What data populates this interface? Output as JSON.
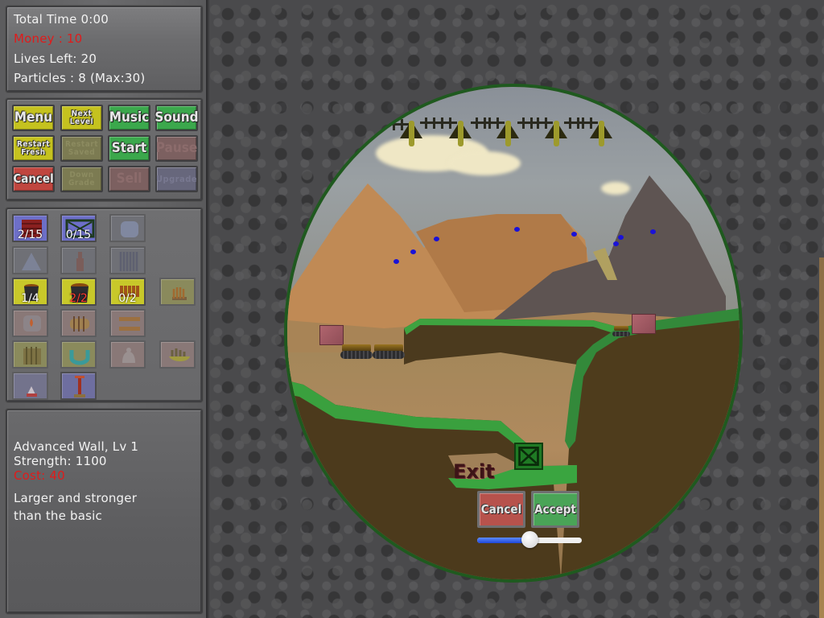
{
  "stats": {
    "total_time": "Total Time 0:00",
    "money": "Money : 10",
    "lives": "Lives Left: 20",
    "particles": "Particles : 8 (Max:30)"
  },
  "controls": [
    {
      "id": "menu",
      "label": "Menu",
      "color": "yellow",
      "enabled": true
    },
    {
      "id": "next-level",
      "label": "Next Level",
      "color": "yellow",
      "enabled": true
    },
    {
      "id": "music",
      "label": "Music",
      "color": "green",
      "enabled": true
    },
    {
      "id": "sound",
      "label": "Sound",
      "color": "green",
      "enabled": true
    },
    {
      "id": "restart-fresh",
      "label": "Restart Fresh",
      "color": "yellow",
      "enabled": true
    },
    {
      "id": "restart-saved",
      "label": "Restart Saved",
      "color": "yellow",
      "enabled": false
    },
    {
      "id": "start",
      "label": "Start",
      "color": "green",
      "enabled": true
    },
    {
      "id": "pause",
      "label": "Pause",
      "color": "red",
      "enabled": false
    },
    {
      "id": "cancel",
      "label": "Cancel",
      "color": "red",
      "enabled": true
    },
    {
      "id": "down-grade",
      "label": "Down Grade",
      "color": "yellow",
      "enabled": false
    },
    {
      "id": "sell",
      "label": "Sell",
      "color": "red",
      "enabled": false
    },
    {
      "id": "upgrade",
      "label": "Upgrade",
      "color": "blue",
      "enabled": false
    }
  ],
  "items": [
    {
      "id": "basic-wall",
      "icon": "brick-wall-icon",
      "count": "2/15",
      "count_color": "white",
      "state": "blue"
    },
    {
      "id": "advanced-wall",
      "icon": "steel-frame-icon",
      "count": "0/15",
      "count_color": "white",
      "state": "blue"
    },
    {
      "id": "dome",
      "icon": "dome-icon",
      "count": "",
      "state": "dim-gray"
    },
    {
      "id": "pyramid",
      "icon": "pyramid-icon",
      "count": "",
      "state": "dim-gray"
    },
    {
      "id": "bottle",
      "icon": "bottle-icon",
      "count": "",
      "state": "dim-gray"
    },
    {
      "id": "spring-coil",
      "icon": "coil-icon",
      "count": "",
      "state": "dim-gray"
    },
    {
      "id": "small-cauldron",
      "icon": "cauldron-icon",
      "count": "1/4",
      "count_color": "white",
      "state": "yellow"
    },
    {
      "id": "large-cauldron",
      "icon": "cauldron-icon",
      "count": "2/2",
      "count_color": "red",
      "state": "yellow"
    },
    {
      "id": "spike-roller",
      "icon": "spike-roller-icon",
      "count": "0/2",
      "count_color": "white",
      "state": "yellow"
    },
    {
      "id": "spike-bed",
      "icon": "spike-bed-icon",
      "count": "",
      "state": "dim-yellow"
    },
    {
      "id": "flame-tank",
      "icon": "flame-tank-icon",
      "count": "",
      "state": "dim-pink"
    },
    {
      "id": "barrel-cannon",
      "icon": "barrel-icon",
      "count": "",
      "state": "dim-pink"
    },
    {
      "id": "plank-stack",
      "icon": "planks-icon",
      "count": "",
      "state": "dim-pink"
    },
    {
      "id": "fence",
      "icon": "fence-icon",
      "count": "",
      "state": "dim-yellow"
    },
    {
      "id": "u-magnet",
      "icon": "magnet-icon",
      "count": "",
      "state": "dim-yellow"
    },
    {
      "id": "bell-pot",
      "icon": "bell-icon",
      "count": "",
      "state": "dim-pink"
    },
    {
      "id": "crown-bowl",
      "icon": "crown-bowl-icon",
      "count": "",
      "state": "dim-pink"
    },
    {
      "id": "lamp-post",
      "icon": "lamp-icon",
      "count": "",
      "state": "dim-blue"
    },
    {
      "id": "tesla-pole",
      "icon": "tesla-icon",
      "count": "",
      "state": "mid-blue"
    }
  ],
  "info": {
    "name": "Advanced Wall, Lv 1",
    "strength": "Strength: 1100",
    "cost": "Cost: 40",
    "description_line1": "Larger and stronger",
    "description_line2": "than the basic"
  },
  "game": {
    "exit_label": "Exit",
    "cancel_label": "Cancel",
    "accept_label": "Accept",
    "slider_value": 0.5,
    "spawner_count": 5,
    "particle_count": 8
  },
  "colors": {
    "money_red": "#e01b1b",
    "particle_blue": "#1a12d8",
    "button_yellow": "#c5c21f",
    "button_green": "#3ba84c",
    "button_red": "#c0463f"
  }
}
